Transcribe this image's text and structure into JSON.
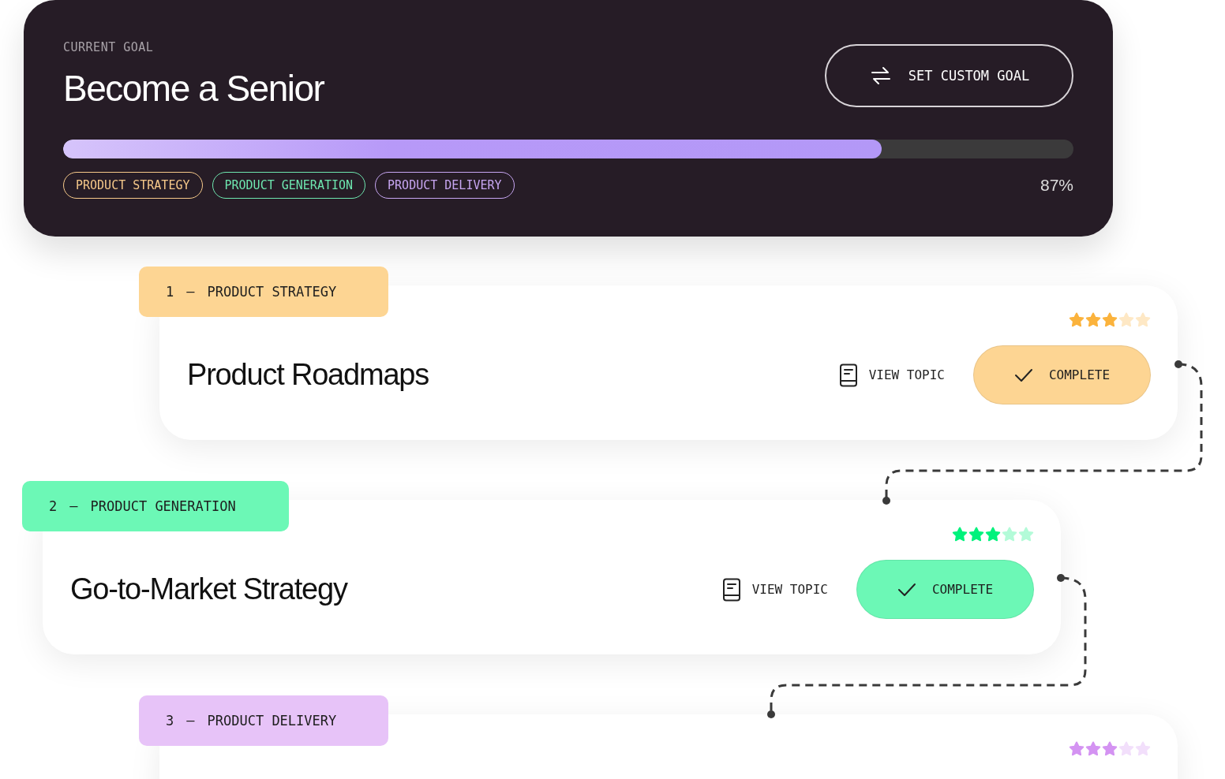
{
  "goal": {
    "caption": "CURRENT GOAL",
    "title": "Become a Senior",
    "button": "SET CUSTOM GOAL",
    "progress": {
      "level": 0.81,
      "reading": "87%"
    },
    "tags": [
      {
        "label": "PRODUCT STRATEGY",
        "color": "#f6c98a"
      },
      {
        "label": "PRODUCT GENERATION",
        "color": "#6ee7b0"
      },
      {
        "label": "PRODUCT DELIVERY",
        "color": "#c7a6f2"
      }
    ]
  },
  "steps": [
    {
      "number": "1",
      "separator": "—",
      "label": "PRODUCT STRATEGY",
      "color": "#fdd593",
      "stars": 3,
      "title": "Product Roadmaps",
      "link": "VIEW TOPIC",
      "button": "COMPLETE"
    },
    {
      "number": "2",
      "separator": "—",
      "label": "PRODUCT GENERATION",
      "color": "#6cf8b6",
      "stars": 3,
      "title": "Go-to-Market Strategy",
      "link": "VIEW TOPIC",
      "button": "COMPLETE"
    },
    {
      "number": "3",
      "separator": "—",
      "label": "PRODUCT DELIVERY",
      "color": "#e7c3f8",
      "stars": 3
    }
  ]
}
